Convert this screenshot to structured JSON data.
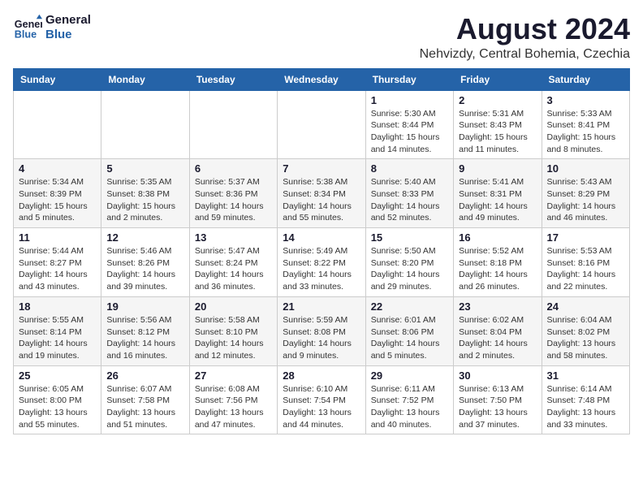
{
  "logo": {
    "line1": "General",
    "line2": "Blue"
  },
  "title": "August 2024",
  "location": "Nehvizdy, Central Bohemia, Czechia",
  "days_of_week": [
    "Sunday",
    "Monday",
    "Tuesday",
    "Wednesday",
    "Thursday",
    "Friday",
    "Saturday"
  ],
  "weeks": [
    [
      {
        "day": "",
        "info": ""
      },
      {
        "day": "",
        "info": ""
      },
      {
        "day": "",
        "info": ""
      },
      {
        "day": "",
        "info": ""
      },
      {
        "day": "1",
        "info": "Sunrise: 5:30 AM\nSunset: 8:44 PM\nDaylight: 15 hours\nand 14 minutes."
      },
      {
        "day": "2",
        "info": "Sunrise: 5:31 AM\nSunset: 8:43 PM\nDaylight: 15 hours\nand 11 minutes."
      },
      {
        "day": "3",
        "info": "Sunrise: 5:33 AM\nSunset: 8:41 PM\nDaylight: 15 hours\nand 8 minutes."
      }
    ],
    [
      {
        "day": "4",
        "info": "Sunrise: 5:34 AM\nSunset: 8:39 PM\nDaylight: 15 hours\nand 5 minutes."
      },
      {
        "day": "5",
        "info": "Sunrise: 5:35 AM\nSunset: 8:38 PM\nDaylight: 15 hours\nand 2 minutes."
      },
      {
        "day": "6",
        "info": "Sunrise: 5:37 AM\nSunset: 8:36 PM\nDaylight: 14 hours\nand 59 minutes."
      },
      {
        "day": "7",
        "info": "Sunrise: 5:38 AM\nSunset: 8:34 PM\nDaylight: 14 hours\nand 55 minutes."
      },
      {
        "day": "8",
        "info": "Sunrise: 5:40 AM\nSunset: 8:33 PM\nDaylight: 14 hours\nand 52 minutes."
      },
      {
        "day": "9",
        "info": "Sunrise: 5:41 AM\nSunset: 8:31 PM\nDaylight: 14 hours\nand 49 minutes."
      },
      {
        "day": "10",
        "info": "Sunrise: 5:43 AM\nSunset: 8:29 PM\nDaylight: 14 hours\nand 46 minutes."
      }
    ],
    [
      {
        "day": "11",
        "info": "Sunrise: 5:44 AM\nSunset: 8:27 PM\nDaylight: 14 hours\nand 43 minutes."
      },
      {
        "day": "12",
        "info": "Sunrise: 5:46 AM\nSunset: 8:26 PM\nDaylight: 14 hours\nand 39 minutes."
      },
      {
        "day": "13",
        "info": "Sunrise: 5:47 AM\nSunset: 8:24 PM\nDaylight: 14 hours\nand 36 minutes."
      },
      {
        "day": "14",
        "info": "Sunrise: 5:49 AM\nSunset: 8:22 PM\nDaylight: 14 hours\nand 33 minutes."
      },
      {
        "day": "15",
        "info": "Sunrise: 5:50 AM\nSunset: 8:20 PM\nDaylight: 14 hours\nand 29 minutes."
      },
      {
        "day": "16",
        "info": "Sunrise: 5:52 AM\nSunset: 8:18 PM\nDaylight: 14 hours\nand 26 minutes."
      },
      {
        "day": "17",
        "info": "Sunrise: 5:53 AM\nSunset: 8:16 PM\nDaylight: 14 hours\nand 22 minutes."
      }
    ],
    [
      {
        "day": "18",
        "info": "Sunrise: 5:55 AM\nSunset: 8:14 PM\nDaylight: 14 hours\nand 19 minutes."
      },
      {
        "day": "19",
        "info": "Sunrise: 5:56 AM\nSunset: 8:12 PM\nDaylight: 14 hours\nand 16 minutes."
      },
      {
        "day": "20",
        "info": "Sunrise: 5:58 AM\nSunset: 8:10 PM\nDaylight: 14 hours\nand 12 minutes."
      },
      {
        "day": "21",
        "info": "Sunrise: 5:59 AM\nSunset: 8:08 PM\nDaylight: 14 hours\nand 9 minutes."
      },
      {
        "day": "22",
        "info": "Sunrise: 6:01 AM\nSunset: 8:06 PM\nDaylight: 14 hours\nand 5 minutes."
      },
      {
        "day": "23",
        "info": "Sunrise: 6:02 AM\nSunset: 8:04 PM\nDaylight: 14 hours\nand 2 minutes."
      },
      {
        "day": "24",
        "info": "Sunrise: 6:04 AM\nSunset: 8:02 PM\nDaylight: 13 hours\nand 58 minutes."
      }
    ],
    [
      {
        "day": "25",
        "info": "Sunrise: 6:05 AM\nSunset: 8:00 PM\nDaylight: 13 hours\nand 55 minutes."
      },
      {
        "day": "26",
        "info": "Sunrise: 6:07 AM\nSunset: 7:58 PM\nDaylight: 13 hours\nand 51 minutes."
      },
      {
        "day": "27",
        "info": "Sunrise: 6:08 AM\nSunset: 7:56 PM\nDaylight: 13 hours\nand 47 minutes."
      },
      {
        "day": "28",
        "info": "Sunrise: 6:10 AM\nSunset: 7:54 PM\nDaylight: 13 hours\nand 44 minutes."
      },
      {
        "day": "29",
        "info": "Sunrise: 6:11 AM\nSunset: 7:52 PM\nDaylight: 13 hours\nand 40 minutes."
      },
      {
        "day": "30",
        "info": "Sunrise: 6:13 AM\nSunset: 7:50 PM\nDaylight: 13 hours\nand 37 minutes."
      },
      {
        "day": "31",
        "info": "Sunrise: 6:14 AM\nSunset: 7:48 PM\nDaylight: 13 hours\nand 33 minutes."
      }
    ]
  ]
}
